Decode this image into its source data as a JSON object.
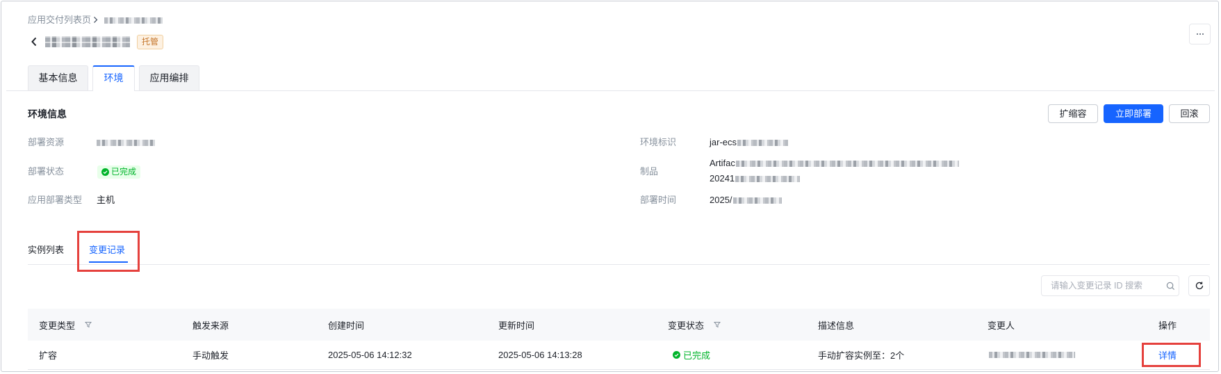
{
  "breadcrumb": {
    "root": "应用交付列表页"
  },
  "header": {
    "badge": "托管"
  },
  "tabs": [
    {
      "label": "基本信息",
      "active": false
    },
    {
      "label": "环境",
      "active": true
    },
    {
      "label": "应用编排",
      "active": false
    }
  ],
  "env_info": {
    "title": "环境信息",
    "actions": {
      "scale": "扩缩容",
      "deploy": "立即部署",
      "rollback": "回滚"
    },
    "fields": {
      "deploy_resource": {
        "label": "部署资源"
      },
      "deploy_status": {
        "label": "部署状态",
        "value": "已完成"
      },
      "deploy_type": {
        "label": "应用部署类型",
        "value": "主机"
      },
      "env_id": {
        "label": "环境标识",
        "value_prefix": "jar-ecs"
      },
      "artifact": {
        "label": "制品",
        "line1_prefix": "Artifac",
        "line2_prefix": "20241"
      },
      "deploy_time": {
        "label": "部署时间",
        "value_prefix": "2025/"
      }
    }
  },
  "subtabs": [
    {
      "label": "实例列表",
      "active": false
    },
    {
      "label": "变更记录",
      "active": true
    }
  ],
  "search": {
    "placeholder": "请输入变更记录 ID 搜索",
    "value": ""
  },
  "table": {
    "columns": [
      "变更类型",
      "触发来源",
      "创建时间",
      "更新时间",
      "变更状态",
      "描述信息",
      "变更人",
      "操作"
    ],
    "rows": [
      {
        "type": "扩容",
        "source": "手动触发",
        "created": "2025-05-06 14:12:32",
        "updated": "2025-05-06 14:13:28",
        "status": "已完成",
        "description": "手动扩容实例至：2个",
        "action": "详情"
      }
    ]
  },
  "colors": {
    "accent": "#1664ff",
    "success": "#00b42a",
    "highlight": "#e5413d",
    "managed_badge": "#c4752a"
  }
}
